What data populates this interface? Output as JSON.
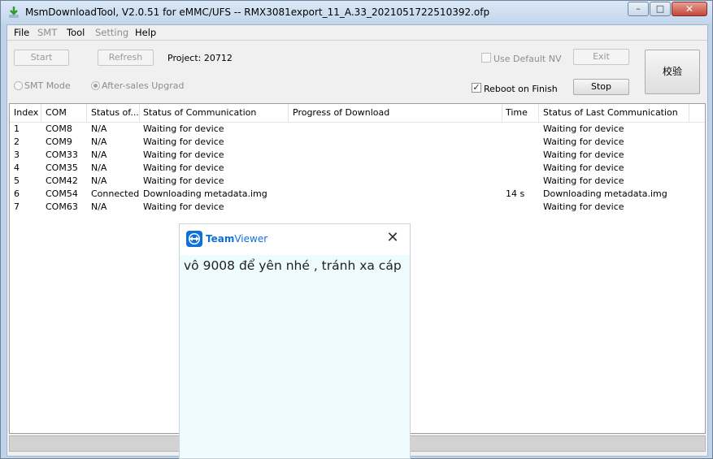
{
  "window": {
    "title": "MsmDownloadTool, V2.0.51 for eMMC/UFS -- RMX3081export_11_A.33_2021051722510392.ofp",
    "icon": "download-app-icon",
    "controls": {
      "minimize": "–",
      "maximize": "□",
      "close": "✕"
    }
  },
  "menu": {
    "file": "File",
    "smt": "SMT",
    "tool": "Tool",
    "setting": "Setting",
    "help": "Help"
  },
  "toolbar": {
    "start": "Start",
    "refresh": "Refresh",
    "project": "Project: 20712",
    "use_default_nv": "Use Default NV",
    "exit": "Exit",
    "verify": "校验",
    "smt_mode": "SMT Mode",
    "after_sales": "After-sales Upgrad",
    "reboot_on_finish": "Reboot on Finish",
    "reboot_checked": "✓",
    "stop": "Stop"
  },
  "table": {
    "headers": {
      "index": "Index",
      "com": "COM",
      "status": "Status of...",
      "communication": "Status of Communication",
      "progress": "Progress of Download",
      "time": "Time",
      "last": "Status of Last Communication"
    },
    "rows": [
      {
        "index": "1",
        "com": "COM8",
        "status": "N/A",
        "comm": "Waiting for device",
        "progress": "",
        "time": "",
        "last": "Waiting for device"
      },
      {
        "index": "2",
        "com": "COM9",
        "status": "N/A",
        "comm": "Waiting for device",
        "progress": "",
        "time": "",
        "last": "Waiting for device"
      },
      {
        "index": "3",
        "com": "COM33",
        "status": "N/A",
        "comm": "Waiting for device",
        "progress": "",
        "time": "",
        "last": "Waiting for device"
      },
      {
        "index": "4",
        "com": "COM35",
        "status": "N/A",
        "comm": "Waiting for device",
        "progress": "",
        "time": "",
        "last": "Waiting for device"
      },
      {
        "index": "5",
        "com": "COM42",
        "status": "N/A",
        "comm": "Waiting for device",
        "progress": "",
        "time": "",
        "last": "Waiting for device"
      },
      {
        "index": "6",
        "com": "COM54",
        "status": "Connected",
        "comm": "Downloading metadata.img",
        "progress": "",
        "time": "14 s",
        "last": "Downloading metadata.img"
      },
      {
        "index": "7",
        "com": "COM63",
        "status": "N/A",
        "comm": "Waiting for device",
        "progress": "",
        "time": "",
        "last": "Waiting for device"
      }
    ]
  },
  "teamviewer": {
    "brand_bold": "Team",
    "brand_rest": "Viewer",
    "close": "✕",
    "message": "vô 9008 để yên nhé , tránh xa cáp",
    "brand_color": "#0e70d8"
  }
}
